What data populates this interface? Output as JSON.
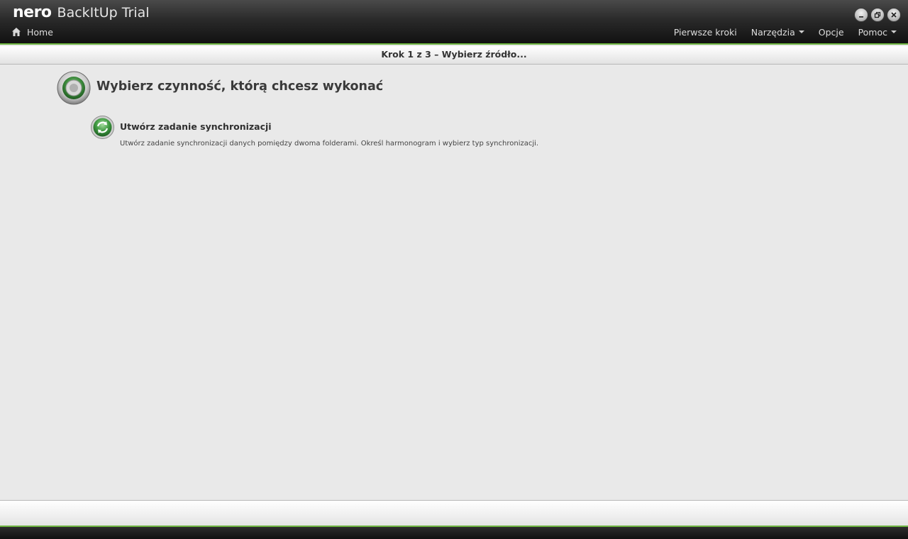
{
  "app": {
    "brand": "nero",
    "title": "BackItUp Trial"
  },
  "header": {
    "home_label": "Home",
    "nav": [
      {
        "label": "Pierwsze kroki"
      },
      {
        "label": "Narzędzia"
      },
      {
        "label": "Opcje"
      },
      {
        "label": "Pomoc"
      }
    ]
  },
  "step": {
    "text": "Krok 1 z 3 – Wybierz źródło..."
  },
  "main": {
    "title": "Wybierz czynność, którą chcesz wykonać",
    "task": {
      "title": "Utwórz zadanie synchronizacji",
      "description": "Utwórz zadanie synchronizacji danych pomiędzy dwoma folderami. Określ harmonogram i wybierz typ synchronizacji."
    }
  },
  "icons": {
    "home": "home-icon",
    "minimize": "minimize-icon",
    "restore": "restore-icon",
    "close": "close-icon",
    "header": "gear-disc-icon",
    "task": "sync-icon"
  },
  "colors": {
    "accent": "#6cb33f",
    "titlebar": "#1e1e1e",
    "background": "#e9e9e9"
  }
}
